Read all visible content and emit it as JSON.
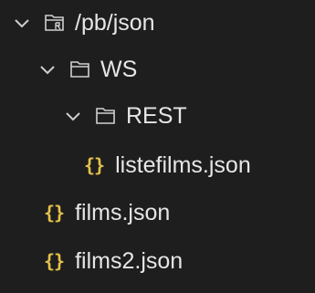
{
  "explorer": {
    "nodes": [
      {
        "type": "folder",
        "expanded": true,
        "label": "/pb/json",
        "icon": "root-folder-icon"
      },
      {
        "type": "folder",
        "expanded": true,
        "label": "WS",
        "icon": "folder-icon"
      },
      {
        "type": "folder",
        "expanded": true,
        "label": "REST",
        "icon": "folder-icon"
      },
      {
        "type": "file",
        "label": "listefilms.json",
        "icon": "json-file-icon",
        "glyph": "{}"
      },
      {
        "type": "file",
        "label": "films.json",
        "icon": "json-file-icon",
        "glyph": "{}"
      },
      {
        "type": "file",
        "label": "films2.json",
        "icon": "json-file-icon",
        "glyph": "{}"
      }
    ]
  },
  "colors": {
    "background": "#1e1e1e",
    "text": "#e6e6e6",
    "json_icon": "#e5c04a"
  }
}
